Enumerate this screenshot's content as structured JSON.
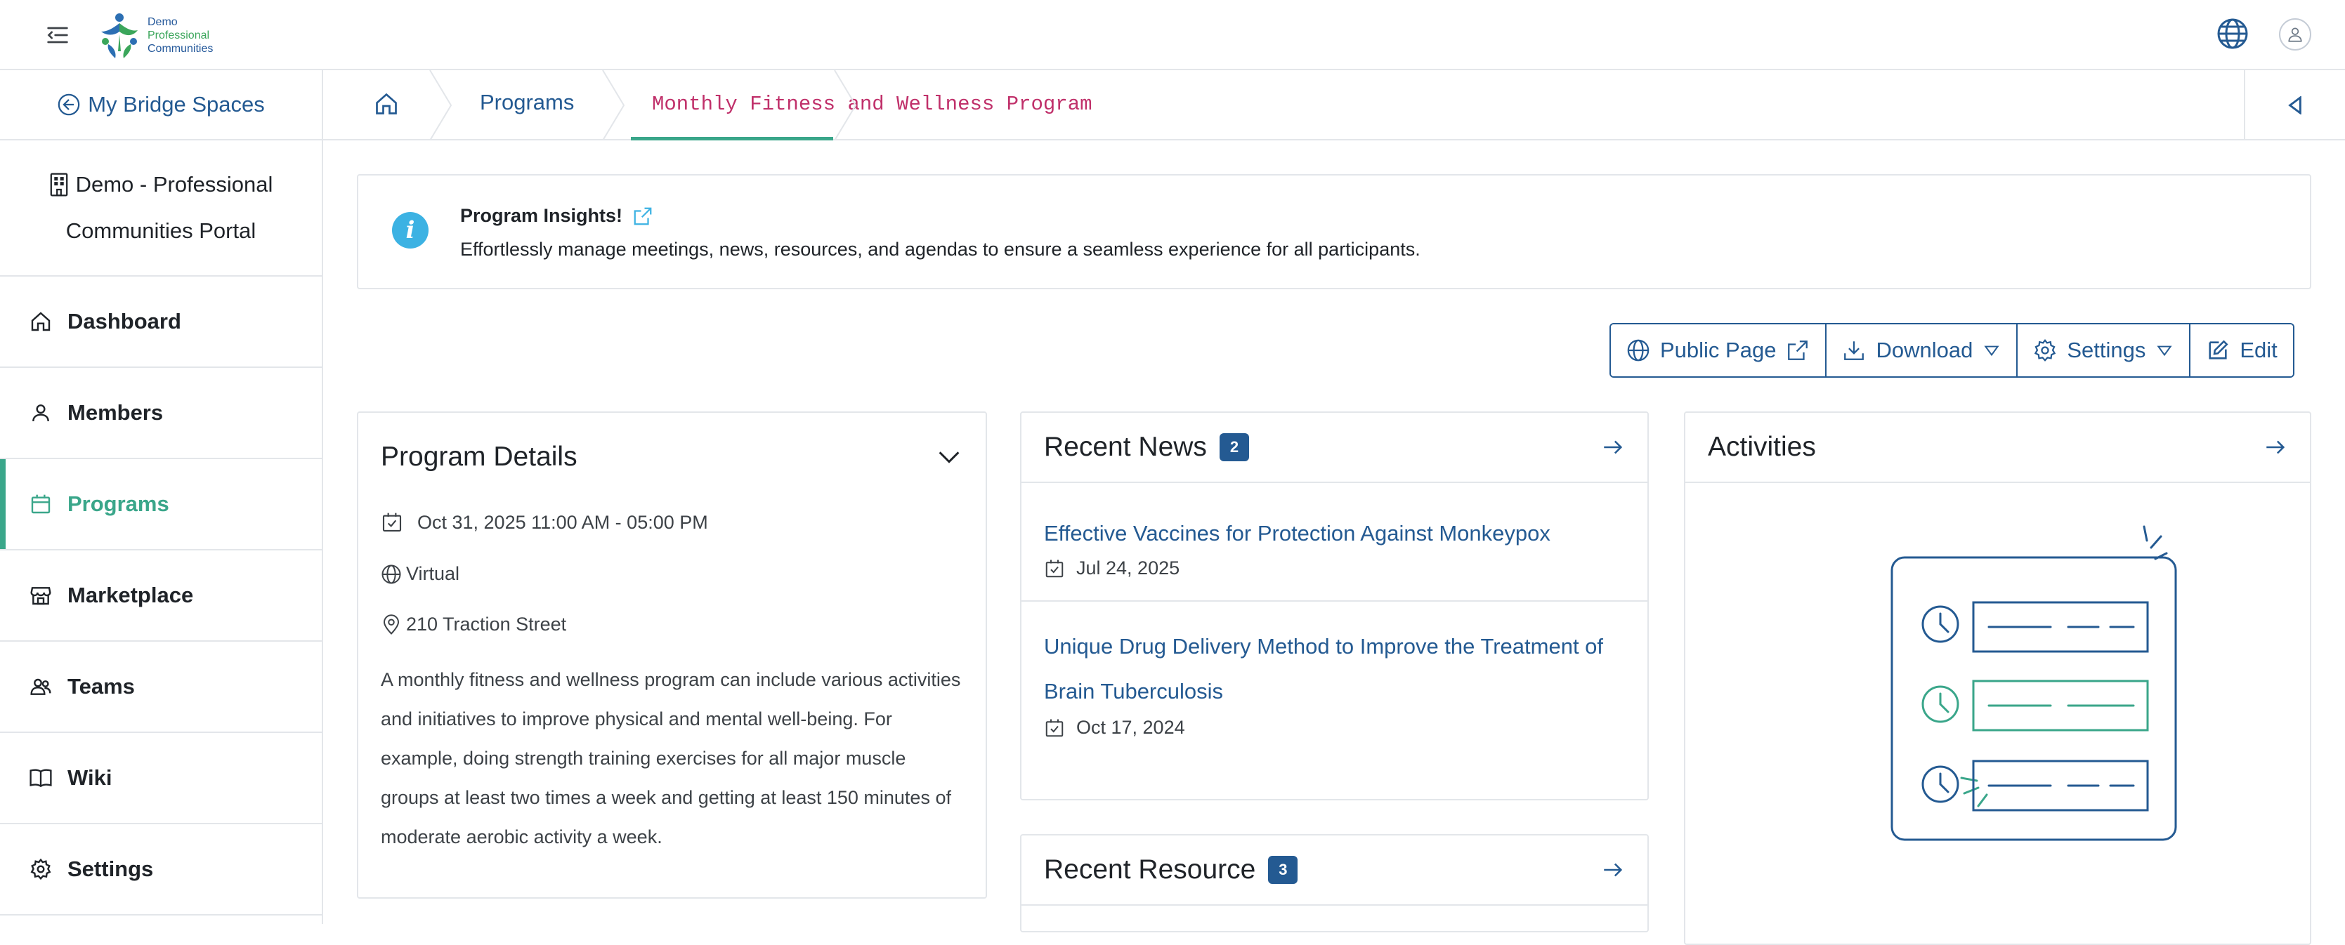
{
  "topbar": {
    "logo_line1": "Demo",
    "logo_line2": "Professional",
    "logo_line3": "Communities"
  },
  "sidebar": {
    "back_label": "My Bridge Spaces",
    "org_line1": "Demo - Professional",
    "org_line2": "Communities Portal",
    "items": [
      {
        "label": "Dashboard",
        "icon": "home-icon"
      },
      {
        "label": "Members",
        "icon": "user-icon"
      },
      {
        "label": "Programs",
        "icon": "calendar-icon",
        "active": true
      },
      {
        "label": "Marketplace",
        "icon": "store-icon"
      },
      {
        "label": "Teams",
        "icon": "people-icon"
      },
      {
        "label": "Wiki",
        "icon": "book-icon"
      },
      {
        "label": "Settings",
        "icon": "gear-icon"
      }
    ]
  },
  "breadcrumb": {
    "programs": "Programs",
    "current": "Monthly Fitness and Wellness Program"
  },
  "insight": {
    "title": "Program Insights!",
    "description": "Effortlessly manage meetings, news, resources, and agendas to ensure a seamless experience for all participants."
  },
  "toolbar": {
    "public_page": "Public Page",
    "download": "Download",
    "settings": "Settings",
    "edit": "Edit"
  },
  "program_details": {
    "title": "Program Details",
    "datetime": "Oct 31, 2025 11:00 AM - 05:00 PM",
    "mode": "Virtual",
    "address": "210 Traction Street",
    "description": "A monthly fitness and wellness program can include various activities and initiatives to improve physical and mental well-being. For example, doing strength training exercises for all major muscle groups at least two times a week and getting at least 150 minutes of moderate aerobic activity a week."
  },
  "recent_news": {
    "title": "Recent News",
    "count": "2",
    "items": [
      {
        "title": "Effective Vaccines for Protection Against Monkeypox",
        "date": "Jul 24, 2025"
      },
      {
        "title": "Unique Drug Delivery Method to Improve the Treatment of Brain Tuberculosis",
        "date": "Oct 17, 2024"
      }
    ]
  },
  "recent_resource": {
    "title": "Recent Resource",
    "count": "3"
  },
  "activities": {
    "title": "Activities"
  },
  "colors": {
    "brand_blue": "#245a92",
    "accent_green": "#3aa68a",
    "breadcrumb_current": "#c0306a",
    "info_blue": "#3cb2e3"
  }
}
